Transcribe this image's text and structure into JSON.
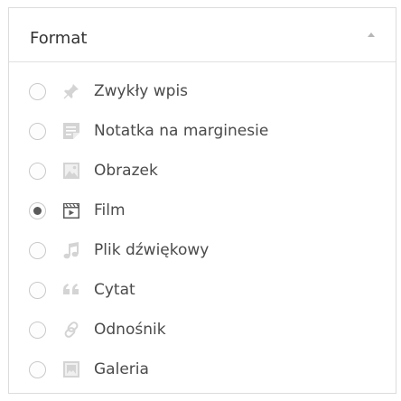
{
  "panel": {
    "title": "Format"
  },
  "formats": [
    {
      "label": "Zwykły wpis",
      "icon": "pushpin-icon",
      "selected": false
    },
    {
      "label": "Notatka na marginesie",
      "icon": "note-icon",
      "selected": false
    },
    {
      "label": "Obrazek",
      "icon": "image-icon",
      "selected": false
    },
    {
      "label": "Film",
      "icon": "video-icon",
      "selected": true
    },
    {
      "label": "Plik dźwiękowy",
      "icon": "music-icon",
      "selected": false
    },
    {
      "label": "Cytat",
      "icon": "quote-icon",
      "selected": false
    },
    {
      "label": "Odnośnik",
      "icon": "link-icon",
      "selected": false
    },
    {
      "label": "Galeria",
      "icon": "gallery-icon",
      "selected": false
    }
  ]
}
